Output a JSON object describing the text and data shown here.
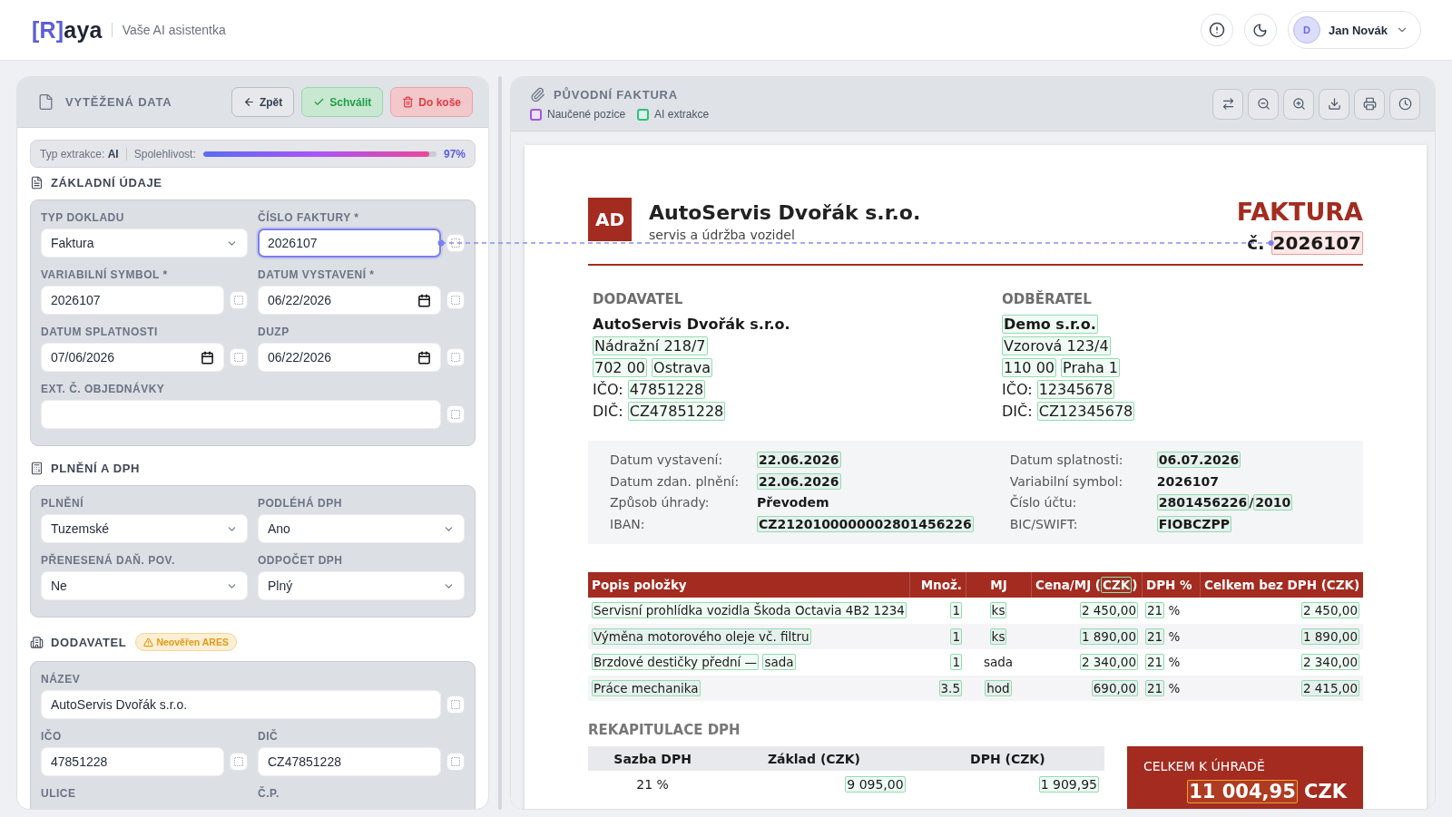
{
  "app_header": {
    "logo_mark": "[R]",
    "logo_text": "aya",
    "tagline": "Vaše AI asistentka",
    "user": {
      "initial": "D",
      "name": "Jan Novák"
    }
  },
  "extracted_panel": {
    "title": "VYTĚŽENÁ DATA",
    "actions": [
      {
        "label": "Zpět",
        "kind": "back"
      },
      {
        "label": "Schválit",
        "kind": "approve"
      },
      {
        "label": "Do koše",
        "kind": "delete"
      }
    ],
    "extraction": {
      "type_text": "Typ extrakce: **AI**",
      "confidence_label": "Spolehlivost:",
      "level": 0.97,
      "reading": "97%"
    },
    "sections": [
      {
        "kind": "basic",
        "title": "ZÁKLADNÍ ÚDAJE",
        "rows": [
          [
            {
              "label": "TYP DOKLADU",
              "kind": "select",
              "value": "Faktura",
              "pick": false,
              "linked": false
            },
            {
              "label": "ČÍSLO FAKTURY *",
              "kind": "text",
              "value": "2026107",
              "pick": true,
              "linked": true
            }
          ],
          [
            {
              "label": "VARIABILNÍ SYMBOL *",
              "kind": "text",
              "value": "2026107",
              "pick": true,
              "linked": false
            },
            {
              "label": "DATUM VYSTAVENÍ *",
              "kind": "date",
              "value": "06/22/2026",
              "pick": true,
              "linked": false
            }
          ],
          [
            {
              "label": "DATUM SPLATNOSTI",
              "kind": "date",
              "value": "07/06/2026",
              "pick": true,
              "linked": false
            },
            {
              "label": "DUZP",
              "kind": "date",
              "value": "06/22/2026",
              "pick": true,
              "linked": false
            }
          ],
          [
            {
              "label": "EXT. Č. OBJEDNÁVKY",
              "kind": "text",
              "pick": true,
              "linked": false
            }
          ]
        ]
      },
      {
        "kind": "vat",
        "title": "PLNĚNÍ A DPH",
        "rows": [
          [
            {
              "label": "PLNĚNÍ",
              "kind": "select",
              "value": "Tuzemské",
              "pick": false,
              "linked": false
            },
            {
              "label": "PODLÉHÁ DPH",
              "kind": "select",
              "value": "Ano",
              "pick": false,
              "linked": false
            }
          ],
          [
            {
              "label": "PŘENESENÁ DAŇ. POV.",
              "kind": "select",
              "value": "Ne",
              "pick": false,
              "linked": false
            },
            {
              "label": "ODPOČET DPH",
              "kind": "select",
              "value": "Plný",
              "pick": false,
              "linked": false
            }
          ]
        ]
      },
      {
        "kind": "party",
        "title": "DODAVATEL",
        "badge": {
          "text": "Neověřen ARES",
          "kind": "warning"
        },
        "rows": [
          [
            {
              "label": "NÁZEV",
              "kind": "text",
              "value": "AutoServis Dvořák s.r.o.",
              "pick": true,
              "linked": false
            }
          ],
          [
            {
              "label": "IČO",
              "kind": "text",
              "value": "47851228",
              "pick": true,
              "linked": false
            },
            {
              "label": "DIČ",
              "kind": "text",
              "value": "CZ47851228",
              "pick": true,
              "linked": false
            }
          ],
          [
            {
              "label": "ULICE"
            },
            {
              "label": "Č.P."
            }
          ]
        ]
      }
    ]
  },
  "original_panel": {
    "title": "PŮVODNÍ FAKTURA",
    "legend": [
      {
        "label": "Naučené pozice",
        "color": "#a259d9"
      },
      {
        "label": "AI extrakce",
        "color": "#2fbf7f"
      }
    ],
    "invoice": {
      "logo": "AD",
      "company": "AutoServis Dvořák s.r.o.",
      "tagline": "servis a údržba vozidel",
      "title": "FAKTURA",
      "number": [
        {
          "text": "č.",
          "kind": "plain"
        },
        {
          "text": "2026107",
          "kind": "linked"
        }
      ],
      "parties": [
        {
          "heading": "DODAVATEL",
          "name": [
            {
              "text": "AutoServis Dvořák s.r.o.",
              "kind": "plain"
            }
          ],
          "lines": [
            [
              {
                "text": "Nádražní 218/7",
                "kind": "ai"
              }
            ],
            [
              {
                "text": "702 00",
                "kind": "ai"
              },
              {
                "text": "Ostrava",
                "kind": "ai"
              }
            ],
            [
              {
                "text": "IČO:",
                "kind": "plain"
              },
              {
                "text": "47851228",
                "kind": "ai"
              }
            ],
            [
              {
                "text": "DIČ:",
                "kind": "plain"
              },
              {
                "text": "CZ47851228",
                "kind": "ai"
              }
            ]
          ]
        },
        {
          "heading": "ODBĚRATEL",
          "name": [
            {
              "text": "Demo s.r.o.",
              "kind": "ai"
            }
          ],
          "lines": [
            [
              {
                "text": "Vzorová 123/4",
                "kind": "ai"
              }
            ],
            [
              {
                "text": "110 00",
                "kind": "ai"
              },
              {
                "text": "Praha 1",
                "kind": "ai"
              }
            ],
            [
              {
                "text": "IČO:",
                "kind": "plain"
              },
              {
                "text": "12345678",
                "kind": "ai"
              }
            ],
            [
              {
                "text": "DIČ:",
                "kind": "plain"
              },
              {
                "text": "CZ12345678",
                "kind": "ai"
              }
            ]
          ]
        }
      ],
      "details": [
        [
          {
            "label": "Datum vystavení:",
            "value": [
              {
                "text": "22.06.2026",
                "kind": "ai"
              }
            ]
          },
          {
            "label": "Datum zdan. plnění:",
            "value": [
              {
                "text": "22.06.2026",
                "kind": "ai"
              }
            ]
          },
          {
            "label": "Způsob úhrady:",
            "value": [
              {
                "text": "Převodem",
                "kind": "plain"
              }
            ]
          },
          {
            "label": "IBAN:",
            "value": [
              {
                "text": "CZ2120100000002801456226",
                "kind": "ai"
              }
            ]
          }
        ],
        [
          {
            "label": "Datum splatnosti:",
            "value": [
              {
                "text": "06.07.2026",
                "kind": "ai"
              }
            ]
          },
          {
            "label": "Variabilní symbol:",
            "value": [
              {
                "text": "2026107",
                "kind": "plain"
              }
            ]
          },
          {
            "label": "Číslo účtu:",
            "value": [
              {
                "text": "2801456226",
                "kind": "ai"
              },
              {
                "text": "/",
                "kind": "plain",
                "attached": true
              },
              {
                "text": "2010",
                "kind": "ai",
                "attached": true
              }
            ]
          },
          {
            "label": "BIC/SWIFT:",
            "value": [
              {
                "text": "FIOBCZPP",
                "kind": "ai"
              }
            ]
          }
        ]
      ],
      "items": {
        "columns": [
          {
            "parts": [
              {
                "text": "Popis položky",
                "kind": "plain"
              }
            ]
          },
          {
            "parts": [
              {
                "text": "Množ.",
                "kind": "plain"
              }
            ]
          },
          {
            "parts": [
              {
                "text": "MJ",
                "kind": "plain"
              }
            ]
          },
          {
            "parts": [
              {
                "text": "Cena/MJ (",
                "kind": "plain"
              },
              {
                "text": "CZK",
                "kind": "ai",
                "attached": true
              },
              {
                "text": ")",
                "kind": "plain",
                "attached": true
              }
            ]
          },
          {
            "parts": [
              {
                "text": "DPH %",
                "kind": "plain"
              }
            ]
          },
          {
            "parts": [
              {
                "text": "Celkem bez DPH (CZK)",
                "kind": "plain"
              }
            ]
          }
        ],
        "rows": [
          [
            {
              "parts": [
                {
                  "text": "Servisní prohlídka vozidla Škoda Octavia 4B2 1234",
                  "kind": "ai"
                }
              ]
            },
            {
              "parts": [
                {
                  "text": "1",
                  "kind": "ai"
                }
              ]
            },
            {
              "parts": [
                {
                  "text": "ks",
                  "kind": "ai"
                }
              ]
            },
            {
              "parts": [
                {
                  "text": "2 450,00",
                  "kind": "ai"
                }
              ]
            },
            {
              "parts": [
                {
                  "text": "21",
                  "kind": "ai"
                },
                {
                  "text": "%",
                  "kind": "plain"
                }
              ]
            },
            {
              "parts": [
                {
                  "text": "2 450,00",
                  "kind": "ai"
                }
              ]
            }
          ],
          [
            {
              "parts": [
                {
                  "text": "Výměna motorového oleje vč. filtru",
                  "kind": "ai"
                }
              ]
            },
            {
              "parts": [
                {
                  "text": "1",
                  "kind": "ai"
                }
              ]
            },
            {
              "parts": [
                {
                  "text": "ks",
                  "kind": "ai"
                }
              ]
            },
            {
              "parts": [
                {
                  "text": "1 890,00",
                  "kind": "ai"
                }
              ]
            },
            {
              "parts": [
                {
                  "text": "21",
                  "kind": "ai"
                },
                {
                  "text": "%",
                  "kind": "plain"
                }
              ]
            },
            {
              "parts": [
                {
                  "text": "1 890,00",
                  "kind": "ai"
                }
              ]
            }
          ],
          [
            {
              "parts": [
                {
                  "text": "Brzdové destičky přední —",
                  "kind": "ai"
                },
                {
                  "text": "sada",
                  "kind": "ai"
                }
              ]
            },
            {
              "parts": [
                {
                  "text": "1",
                  "kind": "ai"
                }
              ]
            },
            {
              "parts": [
                {
                  "text": "sada",
                  "kind": "plain"
                }
              ]
            },
            {
              "parts": [
                {
                  "text": "2 340,00",
                  "kind": "ai"
                }
              ]
            },
            {
              "parts": [
                {
                  "text": "21",
                  "kind": "ai"
                },
                {
                  "text": "%",
                  "kind": "plain"
                }
              ]
            },
            {
              "parts": [
                {
                  "text": "2 340,00",
                  "kind": "ai"
                }
              ]
            }
          ],
          [
            {
              "parts": [
                {
                  "text": "Práce mechanika",
                  "kind": "ai"
                }
              ]
            },
            {
              "parts": [
                {
                  "text": "3.5",
                  "kind": "ai"
                }
              ]
            },
            {
              "parts": [
                {
                  "text": "hod",
                  "kind": "ai"
                }
              ]
            },
            {
              "parts": [
                {
                  "text": "690,00",
                  "kind": "ai"
                }
              ]
            },
            {
              "parts": [
                {
                  "text": "21",
                  "kind": "ai"
                },
                {
                  "text": "%",
                  "kind": "plain"
                }
              ]
            },
            {
              "parts": [
                {
                  "text": "2 415,00",
                  "kind": "ai"
                }
              ]
            }
          ]
        ]
      },
      "vat_summary": {
        "title": "REKAPITULACE DPH",
        "columns": [
          "Sazba DPH",
          "Základ (CZK)",
          "DPH (CZK)"
        ],
        "rows": [
          [
            {
              "parts": [
                {
                  "text": "21 %",
                  "kind": "plain"
                }
              ]
            },
            {
              "parts": [
                {
                  "text": "9 095,00",
                  "kind": "ai"
                }
              ]
            },
            {
              "parts": [
                {
                  "text": "1 909,95",
                  "kind": "ai"
                }
              ]
            }
          ]
        ]
      },
      "total": {
        "label": "CELKEM K ÚHRADĚ",
        "amount": [
          {
            "text": "11 004,95",
            "kind": "amount"
          },
          {
            "text": "CZK",
            "kind": "plain"
          }
        ]
      }
    }
  }
}
